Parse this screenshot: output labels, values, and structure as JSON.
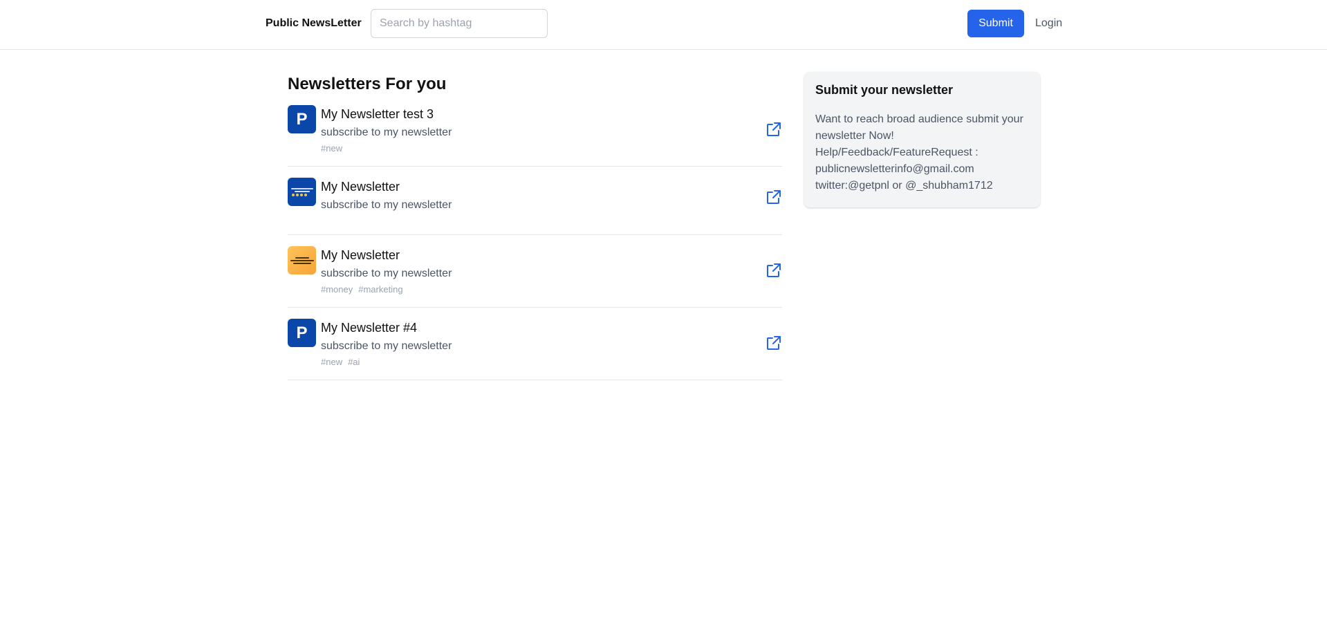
{
  "header": {
    "brand": "Public NewsLetter",
    "search_placeholder": "Search by hashtag",
    "search_value": "",
    "submit_label": "Submit",
    "login_label": "Login"
  },
  "main": {
    "title": "Newsletters For you",
    "items": [
      {
        "title": "My Newsletter test 3",
        "description": "subscribe to my newsletter",
        "avatar_letter": "P",
        "tags": [
          "#new"
        ]
      },
      {
        "title": "My Newsletter",
        "description": "subscribe to my newsletter",
        "avatar_letter": "",
        "tags": []
      },
      {
        "title": "My Newsletter",
        "description": "subscribe to my newsletter",
        "avatar_letter": "",
        "tags": [
          "#money",
          "#marketing"
        ]
      },
      {
        "title": "My Newsletter #4",
        "description": "subscribe to my newsletter",
        "avatar_letter": "P",
        "tags": [
          "#new",
          "#ai"
        ]
      }
    ],
    "open_icon": "external-link-icon"
  },
  "sidebar": {
    "card_title": "Submit your newsletter",
    "card_lines": [
      "Want to reach broad audience submit your newsletter Now!",
      "Help/Feedback/FeatureRequest : publicnewsletterinfo@gmail.com",
      "twitter:@getpnl or @_shubham1712"
    ]
  },
  "colors": {
    "accent": "#2563eb",
    "avatar_blue": "#0a47a9",
    "border": "#e5e7eb",
    "muted_text": "#4b5563",
    "tag_text": "#9ca3af",
    "card_bg": "#f3f4f6"
  }
}
